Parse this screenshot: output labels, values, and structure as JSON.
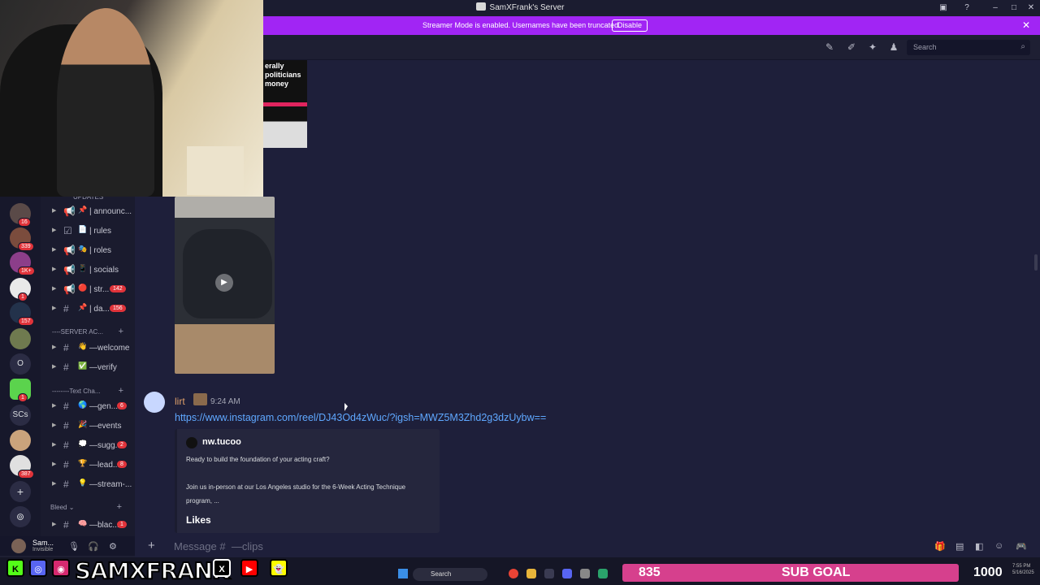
{
  "window": {
    "title": "SamXFrank's Server"
  },
  "banner": {
    "text": "Streamer Mode is enabled. Usernames have been truncated.",
    "button_label": "Disable"
  },
  "header": {
    "search_placeholder": "Search"
  },
  "servers": [
    {
      "badge": "16"
    },
    {
      "badge": "339"
    },
    {
      "badge": "1K+"
    },
    {
      "badge": "1"
    },
    {
      "badge": "157"
    },
    {
      "badge": ""
    },
    {
      "label": "O"
    },
    {
      "badge": "1"
    },
    {
      "label": "SCs"
    },
    {
      "badge": ""
    },
    {
      "badge": "387"
    }
  ],
  "channels": {
    "top_category": "UPDATES",
    "items": [
      {
        "name": "| announc...",
        "emoji": "📌",
        "count": ""
      },
      {
        "name": "| rules",
        "emoji": "📄",
        "count": ""
      },
      {
        "name": "| roles",
        "emoji": "🎭",
        "count": ""
      },
      {
        "name": "| socials",
        "emoji": "📱",
        "count": ""
      },
      {
        "name": "| str...",
        "emoji": "🔴",
        "count": "142"
      },
      {
        "name": "| da...",
        "emoji": "📌",
        "count": "156"
      }
    ],
    "category_server": "SERVER AC...",
    "items2": [
      {
        "name": "—welcome",
        "emoji": "👋",
        "count": ""
      },
      {
        "name": "—verify",
        "emoji": "✅",
        "count": ""
      }
    ],
    "category_text": "Text Cha...",
    "items3": [
      {
        "name": "—gen...",
        "emoji": "🌎",
        "count": "6"
      },
      {
        "name": "—events",
        "emoji": "🎉",
        "count": ""
      },
      {
        "name": "—sugg...",
        "emoji": "💭",
        "count": "2"
      },
      {
        "name": "—lead...",
        "emoji": "🏆",
        "count": "8"
      },
      {
        "name": "—stream-...",
        "emoji": "💡",
        "count": ""
      }
    ],
    "category_bleed": "Bleed",
    "items4": [
      {
        "name": "—blac...",
        "emoji": "🧠",
        "count": "1"
      }
    ]
  },
  "user": {
    "name": "Sam...",
    "status": "Invisible"
  },
  "message": {
    "author": "lirt",
    "time": "9:24 AM",
    "link": "https://www.instagram.com/reel/DJ43Od4zWuc/?igsh=MWZ5M3Zhd2g3dzUybw==",
    "embed": {
      "author": "nw.tucoo",
      "line1": "Ready to build the foundation of your acting craft?",
      "line2": "Join us in-person at our Los Angeles studio for the 6-Week Acting Technique",
      "line3": "program, ...",
      "likes_label": "Likes"
    }
  },
  "image1_caption": "erally politicians money",
  "composer": {
    "placeholder": "Message #  —clips"
  },
  "overlay": {
    "brand": "SAMXFRANK",
    "sub_current": "835",
    "sub_label": "SUB GOAL",
    "sub_goal": "1000",
    "taskbar_search": "Search",
    "clock_time": "7:55 PM",
    "clock_date": "5/16/2025"
  },
  "colors": {
    "banner": "#a125f4",
    "link": "#5fa8ff",
    "badge": "#e0333a",
    "subgoal": "#d6408d"
  }
}
